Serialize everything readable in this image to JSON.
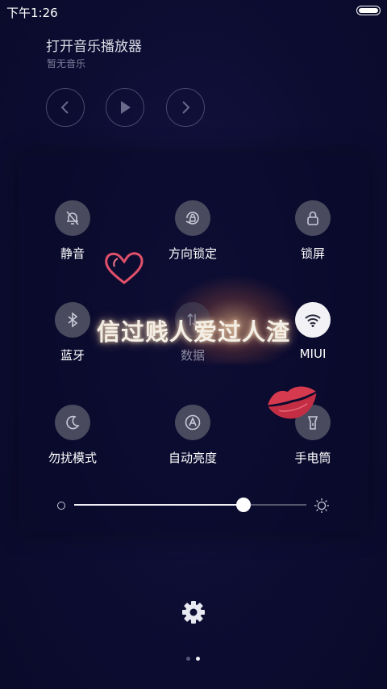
{
  "status_bar": {
    "time": "下午1:26",
    "battery_level": 1.0
  },
  "music": {
    "title": "打开音乐播放器",
    "subtitle": "暂无音乐",
    "controls": {
      "prev_icon": "chevron-left-icon",
      "play_icon": "play-icon",
      "next_icon": "chevron-right-icon"
    }
  },
  "toggles": [
    {
      "label": "静音",
      "icon": "bell-off-icon",
      "active": false
    },
    {
      "label": "方向锁定",
      "icon": "rotation-lock-icon",
      "active": false
    },
    {
      "label": "锁屏",
      "icon": "lock-icon",
      "active": false
    },
    {
      "label": "蓝牙",
      "icon": "bluetooth-icon",
      "active": false
    },
    {
      "label": "数据",
      "icon": "data-icon",
      "active": false
    },
    {
      "label": "MIUI",
      "icon": "wifi-icon",
      "active": true
    },
    {
      "label": "勿扰模式",
      "icon": "moon-icon",
      "active": false
    },
    {
      "label": "自动亮度",
      "icon": "auto-brightness-icon",
      "active": false
    },
    {
      "label": "手电筒",
      "icon": "flashlight-icon",
      "active": false
    }
  ],
  "brightness": {
    "level": 0.73
  },
  "overlay": {
    "text": "信过贱人爱过人渣"
  },
  "pager": {
    "total": 2,
    "current": 2
  },
  "colors": {
    "heart": "#e0506a",
    "lips": "#d63a4e",
    "active_toggle": "#f2f2f6"
  }
}
